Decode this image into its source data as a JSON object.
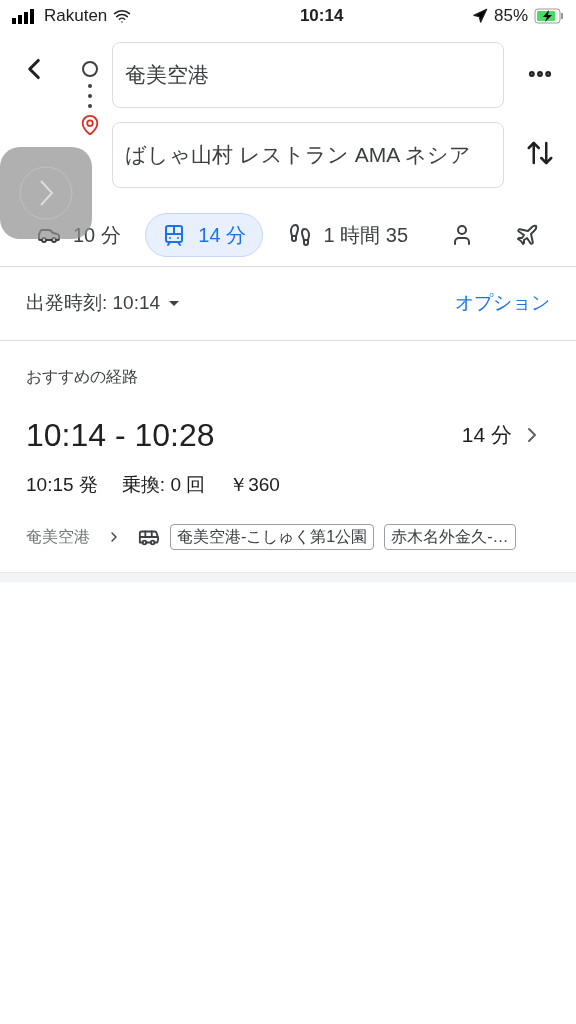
{
  "status_bar": {
    "carrier": "Rakuten",
    "time": "10:14",
    "battery": "85%"
  },
  "route_inputs": {
    "origin": {
      "value": "奄美空港"
    },
    "destination": {
      "value": "ばしゃ山村 レストラン AMA ネシア"
    }
  },
  "modes": [
    {
      "kind": "car",
      "label": "10 分",
      "selected": false
    },
    {
      "kind": "transit",
      "label": "14 分",
      "selected": true
    },
    {
      "kind": "walk",
      "label": "1 時間 35",
      "selected": false
    },
    {
      "kind": "rideshare",
      "selected": false
    },
    {
      "kind": "flight",
      "selected": false
    }
  ],
  "departure": {
    "label": "出発時刻: 10:14",
    "options": "オプション"
  },
  "suggested": {
    "heading": "おすすめの経路",
    "times": "10:14 - 10:28",
    "duration": "14 分",
    "depart": "10:15 発",
    "transfers": "乗換: 0 回",
    "fare": "￥360",
    "from": "奄美空港",
    "lines": [
      "奄美空港-こしゅく第1公園",
      "赤木名外金久-…"
    ]
  }
}
